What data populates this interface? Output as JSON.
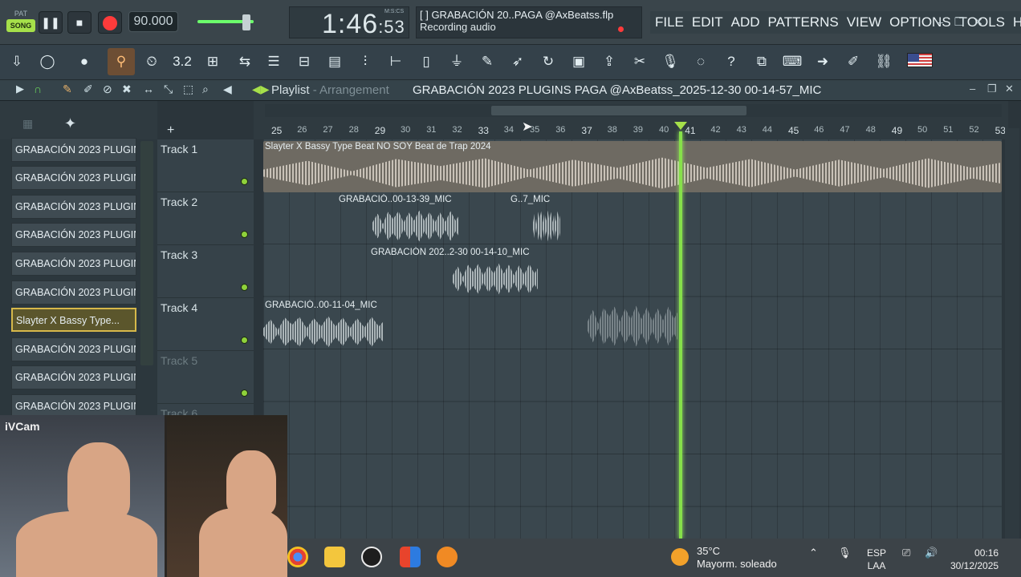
{
  "app": {
    "pat_label": "PAT",
    "song_label": "SONG",
    "tempo": "90.000",
    "time": {
      "main": "1:46",
      "small": ":53",
      "unit": "M:S:CS"
    },
    "hint": {
      "line1": "[  ] GRABACIÓN 20..PAGA @AxBeatss.flp",
      "line2": "Recording audio"
    },
    "menu": [
      "FILE",
      "EDIT",
      "ADD",
      "PATTERNS",
      "VIEW",
      "OPTIONS",
      "TOOLS",
      "HELP"
    ]
  },
  "playlist": {
    "title": "Playlist",
    "subtitle": "- Arrangement",
    "project_name": "GRABACIÓN 2023 PLUGINS PAGA @AxBeatss_2025-12-30 00-14-57_MIC"
  },
  "browser": {
    "items": [
      "GRABACIÓN 2023 PLUGINS...",
      "GRABACIÓN 2023 PLUGINS...",
      "GRABACIÓN 2023 PLUGINS...",
      "GRABACIÓN 2023 PLUGINS...",
      "GRABACIÓN 2023 PLUGINS...",
      "GRABACIÓN 2023 PLUGINS...",
      "Slayter X Bassy Type...",
      "GRABACIÓN 2023 PLUGINS...",
      "GRABACIÓN 2023 PLUGINS...",
      "GRABACIÓN 2023 PLUGINS..."
    ],
    "selected_index": 6
  },
  "tracks": [
    "Track 1",
    "Track 2",
    "Track 3",
    "Track 4",
    "Track 5",
    "Track 6"
  ],
  "ruler": [
    "25",
    "26",
    "27",
    "28",
    "29",
    "30",
    "31",
    "32",
    "33",
    "34",
    "35",
    "36",
    "37",
    "38",
    "39",
    "40",
    "41",
    "42",
    "43",
    "44",
    "45",
    "46",
    "47",
    "48",
    "49",
    "50",
    "51",
    "52",
    "53"
  ],
  "clips": {
    "t1": "Slayter X Bassy Type Beat  NO SOY  Beat de Trap 2024",
    "t2a": "GRABACIÓ..00-13-39_MIC",
    "t2b": "G..7_MIC",
    "t3": "GRABACIÓN 202..2-30 00-14-10_MIC",
    "t4": "GRABACIÓ..00-11-04_MIC"
  },
  "webcam": {
    "label": "iVCam"
  },
  "taskbar": {
    "weather_temp": "35°C",
    "weather_desc": "Mayorm. soleado",
    "lang1": "ESP",
    "lang2": "LAA",
    "time": "00:16",
    "date": "30/12/2025"
  }
}
